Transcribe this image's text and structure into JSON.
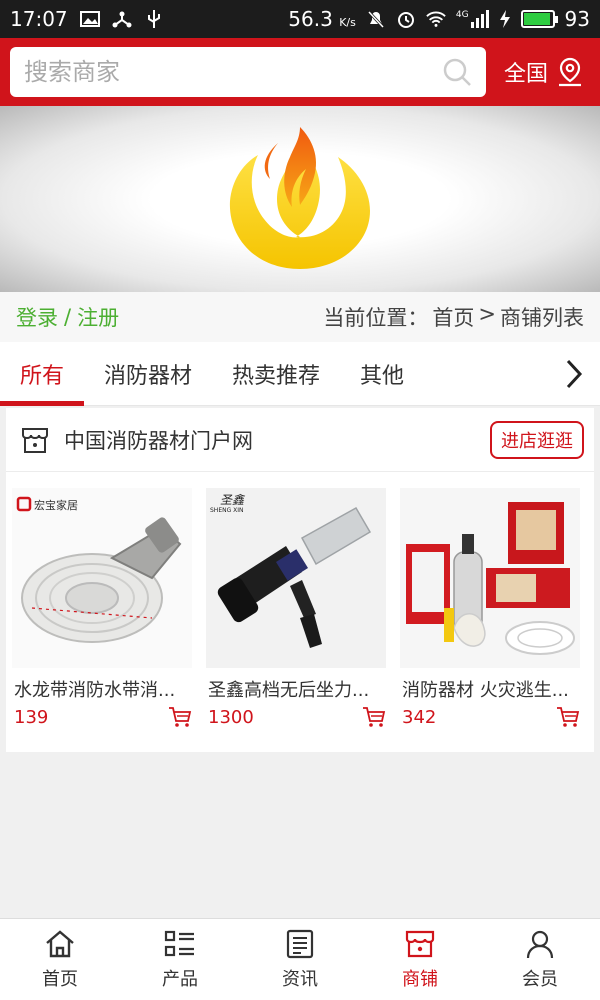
{
  "status_bar": {
    "time": "17:07",
    "network_speed": "56.3",
    "network_speed_unit": "K/s",
    "signal": "4G",
    "battery": "93",
    "battery_level": 0.93
  },
  "header": {
    "search_placeholder": "搜索商家",
    "region_label": "全国"
  },
  "auth": {
    "login": "登录",
    "separator": "/",
    "register": "注册"
  },
  "breadcrumb": {
    "prefix": "当前位置：",
    "home": "首页",
    "arrow": ">",
    "current": "商铺列表"
  },
  "tabs": [
    {
      "label": "所有",
      "active": true
    },
    {
      "label": "消防器材",
      "active": false
    },
    {
      "label": "热卖推荐",
      "active": false
    },
    {
      "label": "其他",
      "active": false
    }
  ],
  "shop": {
    "name": "中国消防器材门户网",
    "visit_label": "进店逛逛",
    "products": [
      {
        "title": "水龙带消防水带消...",
        "price": "139",
        "brand_text": "宏宝家居"
      },
      {
        "title": "圣鑫高档无后坐力...",
        "price": "1300",
        "brand_text": "圣鑫",
        "brand_sub": "SHENG XIN"
      },
      {
        "title": "消防器材 火灾逃生...",
        "price": "342"
      }
    ]
  },
  "bottom_nav": [
    {
      "label": "首页",
      "icon": "home-icon",
      "active": false
    },
    {
      "label": "产品",
      "icon": "list-icon",
      "active": false
    },
    {
      "label": "资讯",
      "icon": "news-icon",
      "active": false
    },
    {
      "label": "商铺",
      "icon": "shop-icon",
      "active": true
    },
    {
      "label": "会员",
      "icon": "user-icon",
      "active": false
    }
  ],
  "colors": {
    "brand_red": "#d0141b",
    "login_green": "#4caf32",
    "logo_yellow": "#f7d21a",
    "logo_orange": "#f08a10"
  }
}
